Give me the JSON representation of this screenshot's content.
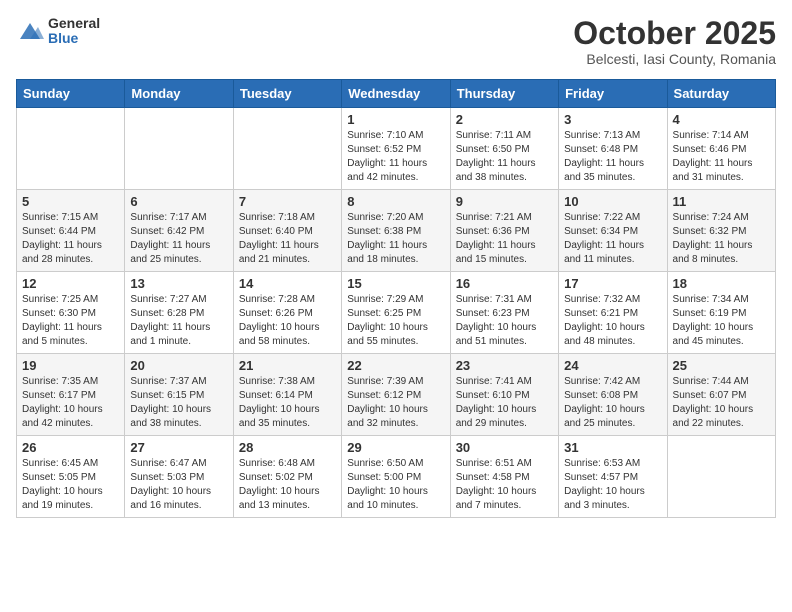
{
  "header": {
    "logo_general": "General",
    "logo_blue": "Blue",
    "month_title": "October 2025",
    "subtitle": "Belcesti, Iasi County, Romania"
  },
  "days_of_week": [
    "Sunday",
    "Monday",
    "Tuesday",
    "Wednesday",
    "Thursday",
    "Friday",
    "Saturday"
  ],
  "weeks": [
    [
      {
        "day": "",
        "info": ""
      },
      {
        "day": "",
        "info": ""
      },
      {
        "day": "",
        "info": ""
      },
      {
        "day": "1",
        "info": "Sunrise: 7:10 AM\nSunset: 6:52 PM\nDaylight: 11 hours and 42 minutes."
      },
      {
        "day": "2",
        "info": "Sunrise: 7:11 AM\nSunset: 6:50 PM\nDaylight: 11 hours and 38 minutes."
      },
      {
        "day": "3",
        "info": "Sunrise: 7:13 AM\nSunset: 6:48 PM\nDaylight: 11 hours and 35 minutes."
      },
      {
        "day": "4",
        "info": "Sunrise: 7:14 AM\nSunset: 6:46 PM\nDaylight: 11 hours and 31 minutes."
      }
    ],
    [
      {
        "day": "5",
        "info": "Sunrise: 7:15 AM\nSunset: 6:44 PM\nDaylight: 11 hours and 28 minutes."
      },
      {
        "day": "6",
        "info": "Sunrise: 7:17 AM\nSunset: 6:42 PM\nDaylight: 11 hours and 25 minutes."
      },
      {
        "day": "7",
        "info": "Sunrise: 7:18 AM\nSunset: 6:40 PM\nDaylight: 11 hours and 21 minutes."
      },
      {
        "day": "8",
        "info": "Sunrise: 7:20 AM\nSunset: 6:38 PM\nDaylight: 11 hours and 18 minutes."
      },
      {
        "day": "9",
        "info": "Sunrise: 7:21 AM\nSunset: 6:36 PM\nDaylight: 11 hours and 15 minutes."
      },
      {
        "day": "10",
        "info": "Sunrise: 7:22 AM\nSunset: 6:34 PM\nDaylight: 11 hours and 11 minutes."
      },
      {
        "day": "11",
        "info": "Sunrise: 7:24 AM\nSunset: 6:32 PM\nDaylight: 11 hours and 8 minutes."
      }
    ],
    [
      {
        "day": "12",
        "info": "Sunrise: 7:25 AM\nSunset: 6:30 PM\nDaylight: 11 hours and 5 minutes."
      },
      {
        "day": "13",
        "info": "Sunrise: 7:27 AM\nSunset: 6:28 PM\nDaylight: 11 hours and 1 minute."
      },
      {
        "day": "14",
        "info": "Sunrise: 7:28 AM\nSunset: 6:26 PM\nDaylight: 10 hours and 58 minutes."
      },
      {
        "day": "15",
        "info": "Sunrise: 7:29 AM\nSunset: 6:25 PM\nDaylight: 10 hours and 55 minutes."
      },
      {
        "day": "16",
        "info": "Sunrise: 7:31 AM\nSunset: 6:23 PM\nDaylight: 10 hours and 51 minutes."
      },
      {
        "day": "17",
        "info": "Sunrise: 7:32 AM\nSunset: 6:21 PM\nDaylight: 10 hours and 48 minutes."
      },
      {
        "day": "18",
        "info": "Sunrise: 7:34 AM\nSunset: 6:19 PM\nDaylight: 10 hours and 45 minutes."
      }
    ],
    [
      {
        "day": "19",
        "info": "Sunrise: 7:35 AM\nSunset: 6:17 PM\nDaylight: 10 hours and 42 minutes."
      },
      {
        "day": "20",
        "info": "Sunrise: 7:37 AM\nSunset: 6:15 PM\nDaylight: 10 hours and 38 minutes."
      },
      {
        "day": "21",
        "info": "Sunrise: 7:38 AM\nSunset: 6:14 PM\nDaylight: 10 hours and 35 minutes."
      },
      {
        "day": "22",
        "info": "Sunrise: 7:39 AM\nSunset: 6:12 PM\nDaylight: 10 hours and 32 minutes."
      },
      {
        "day": "23",
        "info": "Sunrise: 7:41 AM\nSunset: 6:10 PM\nDaylight: 10 hours and 29 minutes."
      },
      {
        "day": "24",
        "info": "Sunrise: 7:42 AM\nSunset: 6:08 PM\nDaylight: 10 hours and 25 minutes."
      },
      {
        "day": "25",
        "info": "Sunrise: 7:44 AM\nSunset: 6:07 PM\nDaylight: 10 hours and 22 minutes."
      }
    ],
    [
      {
        "day": "26",
        "info": "Sunrise: 6:45 AM\nSunset: 5:05 PM\nDaylight: 10 hours and 19 minutes."
      },
      {
        "day": "27",
        "info": "Sunrise: 6:47 AM\nSunset: 5:03 PM\nDaylight: 10 hours and 16 minutes."
      },
      {
        "day": "28",
        "info": "Sunrise: 6:48 AM\nSunset: 5:02 PM\nDaylight: 10 hours and 13 minutes."
      },
      {
        "day": "29",
        "info": "Sunrise: 6:50 AM\nSunset: 5:00 PM\nDaylight: 10 hours and 10 minutes."
      },
      {
        "day": "30",
        "info": "Sunrise: 6:51 AM\nSunset: 4:58 PM\nDaylight: 10 hours and 7 minutes."
      },
      {
        "day": "31",
        "info": "Sunrise: 6:53 AM\nSunset: 4:57 PM\nDaylight: 10 hours and 3 minutes."
      },
      {
        "day": "",
        "info": ""
      }
    ]
  ]
}
